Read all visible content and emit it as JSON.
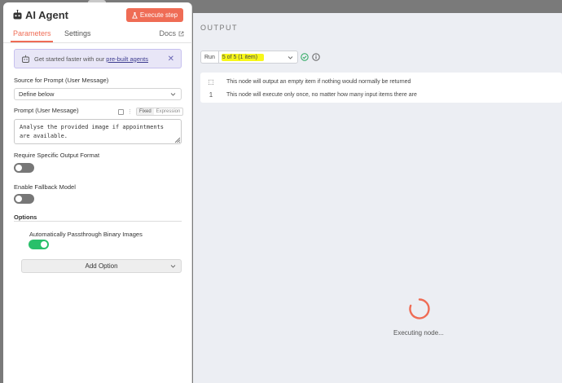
{
  "panel": {
    "title": "AI Agent",
    "execute_label": "Execute step",
    "tabs": [
      "Parameters",
      "Settings"
    ],
    "docs_label": "Docs"
  },
  "banner": {
    "text": "Get started faster with our",
    "link": "pre-built agents"
  },
  "source": {
    "label": "Source for Prompt (User Message)",
    "value": "Define below"
  },
  "prompt": {
    "label": "Prompt (User Message)",
    "fixed_label": "Fixed",
    "expression_label": "Expression",
    "text": "Analyse the provided image if appointments\nare available."
  },
  "options_fields": {
    "require_format_label": "Require Specific Output Format",
    "require_format_on": false,
    "fallback_label": "Enable Fallback Model",
    "fallback_on": false,
    "options_label": "Options",
    "passthrough_label": "Automatically Passthrough Binary Images",
    "passthrough_on": true,
    "add_option_label": "Add Option"
  },
  "output": {
    "title": "OUTPUT",
    "run_label": "Run",
    "run_select": "5 of 5 (1 item)",
    "notes": [
      "This node will output an empty item if nothing would normally be returned",
      "This node will execute only once, no matter how many input items there are"
    ],
    "status": "Executing node..."
  },
  "colors": {
    "accent": "#ef6c55",
    "toggle_on": "#29c06a",
    "highlight": "#f7f71a"
  }
}
